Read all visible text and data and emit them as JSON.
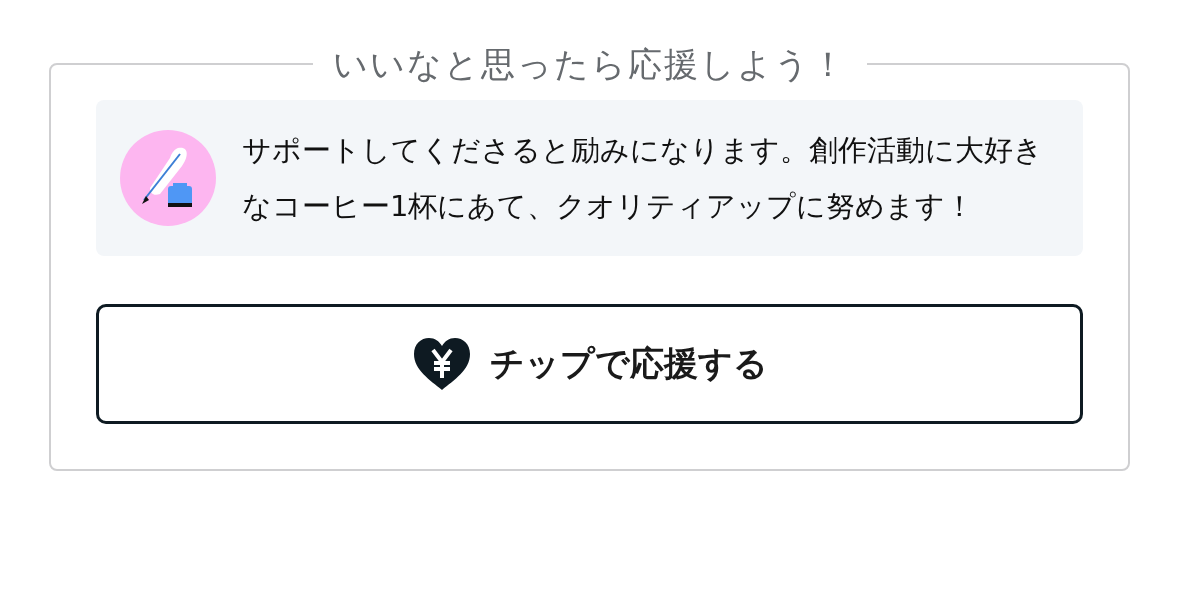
{
  "panel": {
    "title": "いいなと思ったら応援しよう！",
    "message": {
      "text": "サポートしてくださると励みになります。創作活動に大好きなコーヒー1杯にあて、クオリティアップに努めます！"
    },
    "button": {
      "label": "チップで応援する"
    }
  }
}
